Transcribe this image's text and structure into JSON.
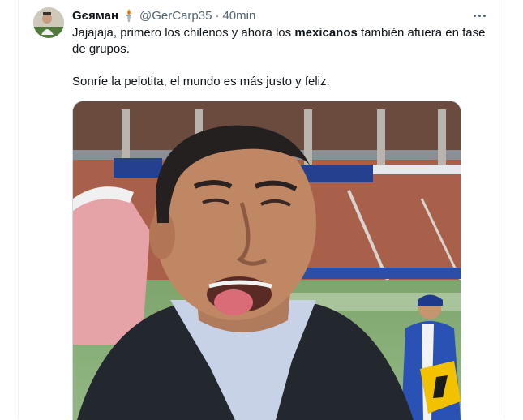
{
  "tweet": {
    "display_name": "Gєяман",
    "handle": "@GerCarp35",
    "separator": "·",
    "time": "40min",
    "text_line1_part1": "Jajajaja, primero los chilenos y ahora los ",
    "text_line1_bold": "mexicanos",
    "text_line1_part2": " también afuera en fase de grupos.",
    "text_line2": "Sonríe la pelotita, el mundo es más justo y feliz.",
    "badge_icon": "torch-icon",
    "more_icon": "more-horizontal-icon"
  },
  "colors": {
    "secondary_text": "#536471",
    "primary_text": "#0f1419",
    "border": "#cfd9de"
  }
}
